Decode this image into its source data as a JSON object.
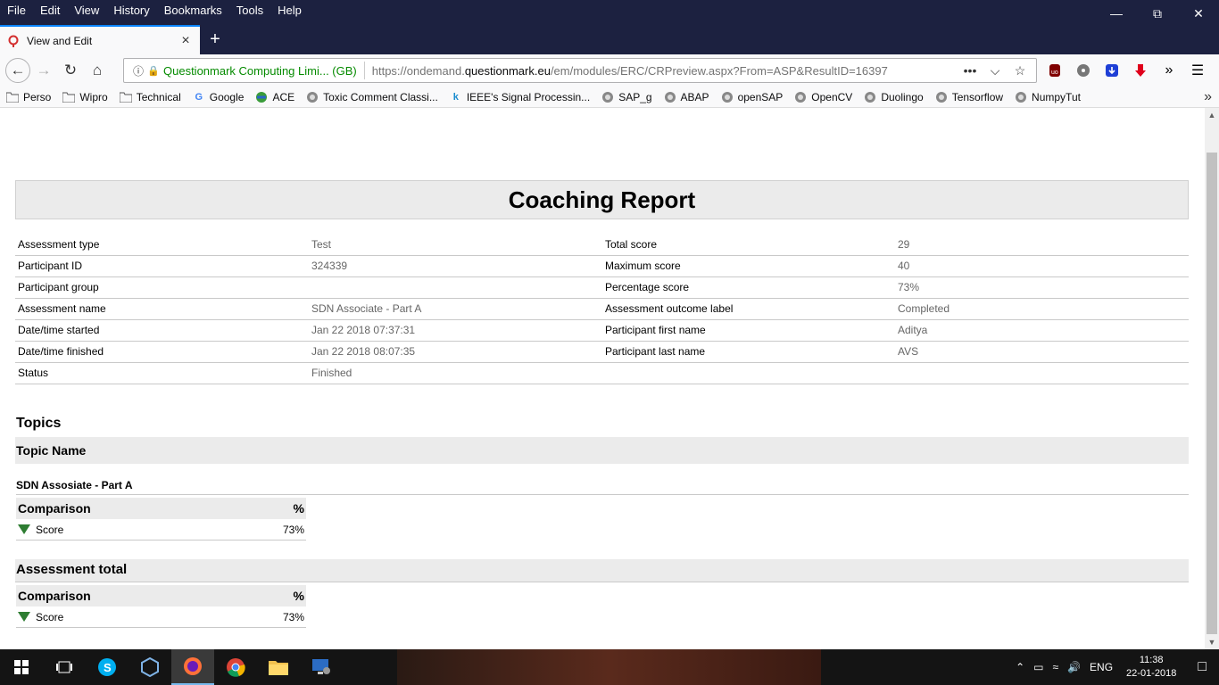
{
  "menubar": {
    "items": [
      {
        "label": "File"
      },
      {
        "label": "Edit"
      },
      {
        "label": "View"
      },
      {
        "label": "History"
      },
      {
        "label": "Bookmarks"
      },
      {
        "label": "Tools"
      },
      {
        "label": "Help"
      }
    ]
  },
  "tab": {
    "title": "View and Edit"
  },
  "urlbar": {
    "org": "Questionmark Computing Limi... (GB)",
    "url_prefix": "https://ondemand.",
    "url_domain": "questionmark.eu",
    "url_suffix": "/em/modules/ERC/CRPreview.aspx?From=ASP&ResultID=16397"
  },
  "bookmarks": [
    {
      "label": "Perso",
      "icon": "folder-icon"
    },
    {
      "label": "Wipro",
      "icon": "folder-icon"
    },
    {
      "label": "Technical",
      "icon": "folder-icon"
    },
    {
      "label": "Google",
      "icon": "google-icon"
    },
    {
      "label": "ACE",
      "icon": "globe-icon"
    },
    {
      "label": "Toxic Comment Classi...",
      "icon": "web-icon"
    },
    {
      "label": "IEEE's Signal Processin...",
      "icon": "k-icon"
    },
    {
      "label": "SAP_g",
      "icon": "web-icon"
    },
    {
      "label": "ABAP",
      "icon": "web-icon"
    },
    {
      "label": "openSAP",
      "icon": "web-icon"
    },
    {
      "label": "OpenCV",
      "icon": "web-icon"
    },
    {
      "label": "Duolingo",
      "icon": "web-icon"
    },
    {
      "label": "Tensorflow",
      "icon": "web-icon"
    },
    {
      "label": "NumpyTut",
      "icon": "web-icon"
    }
  ],
  "report": {
    "title": "Coaching Report",
    "rows": [
      {
        "l1": "Assessment type",
        "v1": "Test",
        "l2": "Total score",
        "v2": "29"
      },
      {
        "l1": "Participant ID",
        "v1": "324339",
        "l2": "Maximum score",
        "v2": "40"
      },
      {
        "l1": "Participant group",
        "v1": "",
        "l2": "Percentage score",
        "v2": "73%"
      },
      {
        "l1": "Assessment name",
        "v1": "SDN Associate - Part A",
        "l2": "Assessment outcome label",
        "v2": "Completed"
      },
      {
        "l1": "Date/time started",
        "v1": "Jan 22 2018 07:37:31",
        "l2": "Participant first name",
        "v2": "Aditya"
      },
      {
        "l1": "Date/time finished",
        "v1": "Jan 22 2018 08:07:35",
        "l2": "Participant last name",
        "v2": "AVS"
      },
      {
        "l1": "Status",
        "v1": "Finished",
        "l2": "",
        "v2": ""
      }
    ],
    "topics_heading": "Topics",
    "topic_name_header": "Topic Name",
    "topic": {
      "name": "SDN Assosiate - Part A",
      "comparison_label": "Comparison",
      "percent_label": "%",
      "score_label": "Score",
      "score_value": "73%"
    },
    "total": {
      "heading": "Assessment total",
      "comparison_label": "Comparison",
      "percent_label": "%",
      "score_label": "Score",
      "score_value": "73%"
    }
  },
  "taskbar": {
    "lang": "ENG",
    "time": "11:38",
    "date": "22-01-2018"
  },
  "colors": {
    "chrome_dark": "#1c2140",
    "secure_green": "#058b00",
    "score_triangle": "#2e7d32"
  }
}
